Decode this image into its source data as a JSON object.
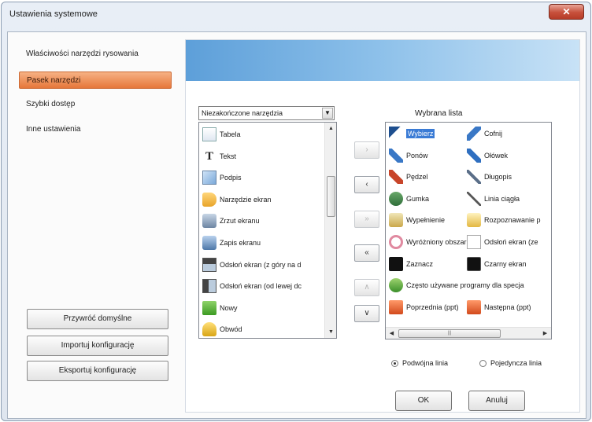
{
  "window": {
    "title": "Ustawienia systemowe",
    "close_glyph": "✕"
  },
  "sidebar": {
    "items": [
      {
        "label": "Właściwości narzędzi rysowania"
      },
      {
        "label": "Pasek narzędzi"
      },
      {
        "label": "Szybki dostęp"
      },
      {
        "label": "Inne ustawienia"
      }
    ],
    "buttons": {
      "restore": "Przywróć domyślne",
      "import": "Importuj konfigurację",
      "export": "Eksportuj konfigurację"
    }
  },
  "tools_panel": {
    "dropdown_value": "Niezakończone narzędzia",
    "available_list": [
      {
        "label": "Tabela",
        "icon": "table-icon"
      },
      {
        "label": "Tekst",
        "icon": "text-icon"
      },
      {
        "label": "Podpis",
        "icon": "signature-icon"
      },
      {
        "label": "Narzędzie ekran",
        "icon": "screen-tool-icon"
      },
      {
        "label": "Zrzut ekranu",
        "icon": "screenshot-icon"
      },
      {
        "label": "Zapis ekranu",
        "icon": "screen-record-icon"
      },
      {
        "label": "Odsłoń ekran (z góry na d",
        "icon": "reveal-top-icon"
      },
      {
        "label": "Odsłoń ekran (od lewej dc",
        "icon": "reveal-left-icon"
      },
      {
        "label": "Nowy",
        "icon": "new-page-icon"
      },
      {
        "label": "Obwód",
        "icon": "perimeter-icon"
      }
    ],
    "move_buttons": {
      "add": "›",
      "remove": "‹",
      "add_all": "»",
      "remove_all": "«",
      "up": "∧",
      "down": "∨"
    },
    "selected_label": "Wybrana lista",
    "selected_list": [
      [
        {
          "label": "Wybierz",
          "icon": "select-arrow-icon",
          "highlight": true
        },
        {
          "label": "Cofnij",
          "icon": "undo-icon"
        }
      ],
      [
        {
          "label": "Ponów",
          "icon": "redo-icon"
        },
        {
          "label": "Ołówek",
          "icon": "pencil-icon"
        }
      ],
      [
        {
          "label": "Pędzel",
          "icon": "brush-icon"
        },
        {
          "label": "Długopis",
          "icon": "pen-icon"
        }
      ],
      [
        {
          "label": "Gumka",
          "icon": "eraser-icon"
        },
        {
          "label": "Linia ciągła",
          "icon": "line-icon"
        }
      ],
      [
        {
          "label": "Wypełnienie",
          "icon": "fill-icon"
        },
        {
          "label": "Rozpoznawanie p",
          "icon": "recognition-icon"
        }
      ],
      [
        {
          "label": "Wyróżniony obszar",
          "icon": "highlight-area-icon"
        },
        {
          "label": "Odsłoń ekran (ze",
          "icon": "reveal-screen-icon"
        }
      ],
      [
        {
          "label": "Zaznacz",
          "icon": "mark-icon"
        },
        {
          "label": "Czarny ekran",
          "icon": "black-screen-icon"
        }
      ],
      [
        {
          "label": "Często używane programy dla specja",
          "icon": "programs-icon"
        }
      ],
      [
        {
          "label": "Poprzednia (ppt)",
          "icon": "ppt-prev-icon"
        },
        {
          "label": "Następna (ppt)",
          "icon": "ppt-next-icon"
        }
      ]
    ],
    "radio": {
      "double": "Podwójna linia",
      "single": "Pojedyncza linia",
      "selected": "double"
    }
  },
  "footer": {
    "ok": "OK",
    "cancel": "Anuluj"
  },
  "colors": {
    "active_nav": "#e6773a",
    "banner": "#5d9fd9",
    "selection": "#3a7bd5"
  }
}
